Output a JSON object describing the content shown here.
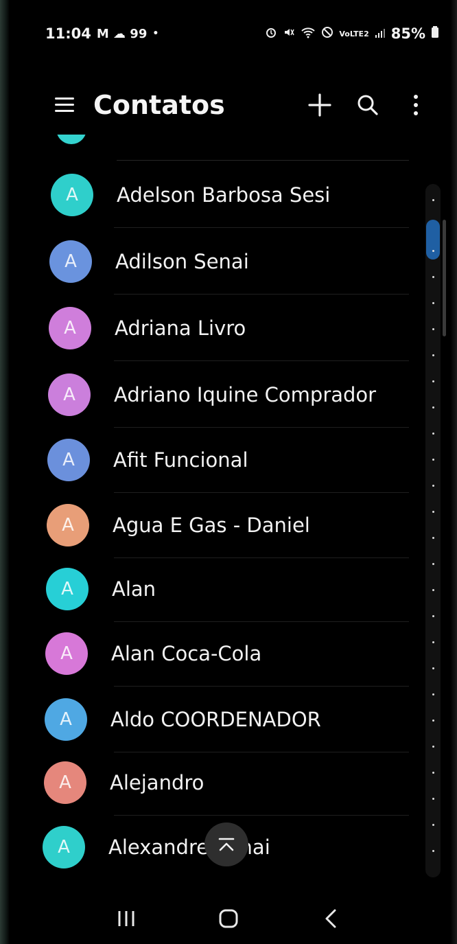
{
  "status_bar": {
    "time": "11:04",
    "left_indicators": "M ☁ 99",
    "dot": "•",
    "network": "VoLTE2",
    "battery": "85%"
  },
  "app_bar": {
    "title": "Contatos",
    "icons": [
      "menu-icon",
      "plus-icon",
      "search-icon",
      "more-vert-icon"
    ]
  },
  "contacts": [
    {
      "name": "Adelson Barbosa Sesi",
      "initial": "A",
      "color": "#2fcfcb"
    },
    {
      "name": "Adilson Senai",
      "initial": "A",
      "color": "#6a93de"
    },
    {
      "name": "Adriana Livro",
      "initial": "A",
      "color": "#cf7edb"
    },
    {
      "name": "Adriano Iquine Comprador",
      "initial": "A",
      "color": "#cb7fdc"
    },
    {
      "name": "Afit Funcional",
      "initial": "A",
      "color": "#6b90dc"
    },
    {
      "name": "Agua E Gas - Daniel",
      "initial": "A",
      "color": "#e89e78"
    },
    {
      "name": "Alan",
      "initial": "A",
      "color": "#27cfd6"
    },
    {
      "name": "Alan Coca-Cola",
      "initial": "A",
      "color": "#d778d8"
    },
    {
      "name": "Aldo COORDENADOR",
      "initial": "A",
      "color": "#4fa8e3"
    },
    {
      "name": "Alejandro",
      "initial": "A",
      "color": "#e5877c"
    },
    {
      "name": "Alexandre Senai",
      "initial": "A",
      "color": "#2fcfcb"
    }
  ],
  "scroll_top_icon": "scroll-to-top-icon",
  "nav_bar": {
    "icons": [
      "recents-icon",
      "home-icon",
      "back-icon"
    ]
  }
}
